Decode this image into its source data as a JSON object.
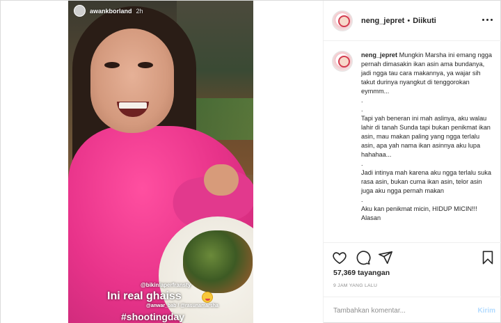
{
  "story": {
    "username": "awankborland",
    "time": "2h",
    "mention_1": "@bikinlaperfransty",
    "caption_big": "Ini real ghaiss",
    "mention_2": "@anwar_bab / @rasunamarsha",
    "hashtag": "#shootingday"
  },
  "header": {
    "username": "neng_jepret",
    "separator": "•",
    "follow_status": "Diikuti"
  },
  "caption": {
    "author": "neng_jepret",
    "text": " Mungkin Marsha ini emang ngga pernah dimasakin ikan asin ama bundanya, jadi ngga tau cara makannya, ya wajar sih takut durinya nyangkut di tenggorokan eymmm...\n.\n.\nTapi yah beneran ini mah aslinya, aku walau lahir di tanah Sunda tapi bukan penikmat ikan asin, mau makan paling yang ngga terlalu asin, apa yah nama ikan asinnya aku lupa hahahaa...\n.\nJadi intinya mah karena aku ngga terlalu suka rasa asin, bukan cuma ikan asin, telor asin juga aku ngga pernah makan\n.\nAku kan penikmat micin, HIDUP MICIN!!! Alasan"
  },
  "stats": {
    "views": "57,369 tayangan",
    "time_ago": "9 JAM YANG LALU"
  },
  "comment": {
    "placeholder": "Tambahkan komentar...",
    "post_label": "Kirim"
  },
  "icons": {
    "like": "heart-icon",
    "comment": "comment-icon",
    "share": "share-icon",
    "save": "bookmark-icon",
    "more": "more-icon"
  }
}
